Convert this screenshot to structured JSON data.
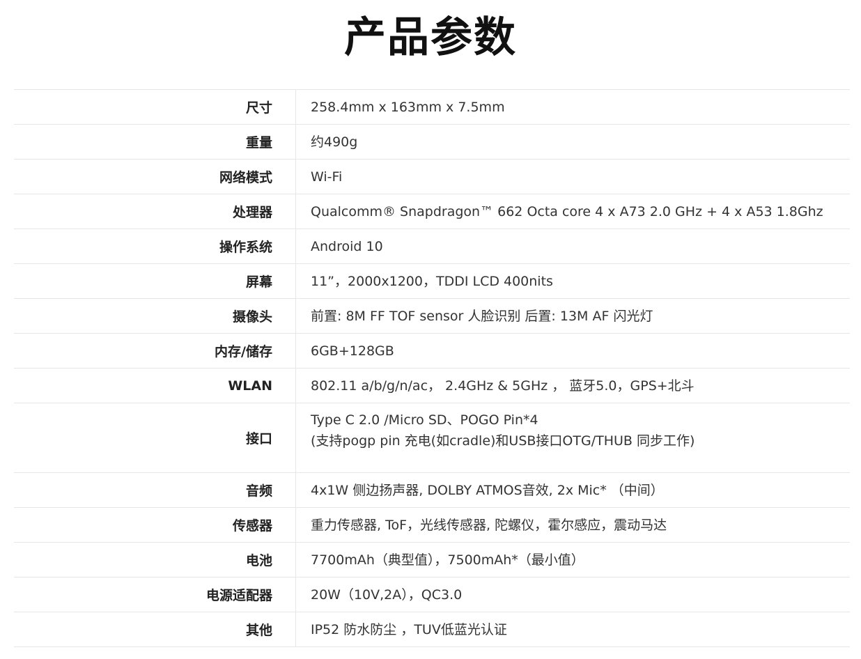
{
  "title": "产品参数",
  "specs": [
    {
      "label": "尺寸",
      "lines": [
        "258.4mm x 163mm x 7.5mm"
      ]
    },
    {
      "label": "重量",
      "lines": [
        "约490g"
      ]
    },
    {
      "label": "网络模式",
      "lines": [
        "Wi-Fi"
      ]
    },
    {
      "label": "处理器",
      "lines": [
        "Qualcomm® Snapdragon™ 662 Octa core 4 x A73 2.0 GHz + 4 x A53 1.8Ghz"
      ]
    },
    {
      "label": "操作系统",
      "lines": [
        "Android 10"
      ]
    },
    {
      "label": "屏幕",
      "lines": [
        "11”，2000x1200，TDDI LCD 400nits"
      ]
    },
    {
      "label": "摄像头",
      "lines": [
        "前置: 8M FF TOF sensor  人脸识别  后置: 13M AF 闪光灯"
      ]
    },
    {
      "label": "内存/储存",
      "lines": [
        "6GB+128GB"
      ]
    },
    {
      "label": "WLAN",
      "lines": [
        "802.11 a/b/g/n/ac， 2.4GHz & 5GHz ，  蓝牙5.0，GPS+北斗"
      ]
    },
    {
      "label": "接口",
      "lines": [
        "Type C 2.0 /Micro SD、POGO Pin*4",
        "(支持pogp pin 充电(如cradle)和USB接口OTG/THUB 同步工作)"
      ]
    },
    {
      "label": "音频",
      "lines": [
        "4x1W 侧边扬声器, DOLBY ATMOS音效, 2x Mic* （中间）"
      ]
    },
    {
      "label": "传感器",
      "lines": [
        "重力传感器, ToF，光线传感器, 陀螺仪，霍尔感应，震动马达"
      ]
    },
    {
      "label": "电池",
      "lines": [
        "7700mAh（典型值），7500mAh*（最小值）"
      ]
    },
    {
      "label": "电源适配器",
      "lines": [
        "20W（10V,2A），QC3.0"
      ]
    },
    {
      "label": "其他",
      "lines": [
        "IP52 防水防尘 ，TUV低蓝光认证"
      ]
    }
  ]
}
